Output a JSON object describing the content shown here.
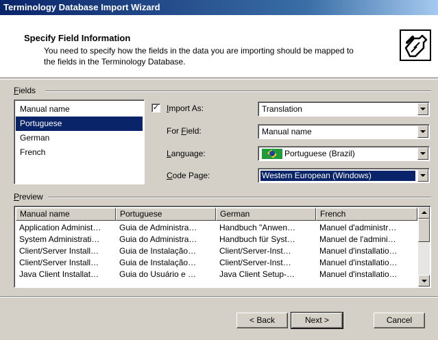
{
  "window": {
    "title": "Terminology Database Import Wizard"
  },
  "header": {
    "title": "Specify Field Information",
    "description": "You need to specify how the fields in the data you are importing should be mapped to the fields in the Terminology Database.",
    "logo_icon": "wizard-tools-icon"
  },
  "fields": {
    "group_label": "Fields",
    "items": [
      "Manual name",
      "Portuguese",
      "German",
      "French"
    ],
    "selected_index": 1
  },
  "import_as": {
    "checked": true,
    "check_glyph": "✓",
    "label": "Import As:",
    "value": "Translation"
  },
  "for_field": {
    "label": "For Field:",
    "value": "Manual name"
  },
  "language": {
    "label": "Language:",
    "value": "Portuguese (Brazil)",
    "flag_icon": "brazil-flag-icon"
  },
  "code_page": {
    "label": "Code Page:",
    "value": "Western European (Windows)"
  },
  "preview": {
    "group_label": "Preview",
    "columns": [
      "Manual name",
      "Portuguese",
      "German",
      "French"
    ],
    "rows": [
      [
        "Application Administ…",
        "Guia de Administra…",
        "Handbuch \"Anwen…",
        "Manuel d'administr…"
      ],
      [
        "System Administrati…",
        "Guia do Administra…",
        "Handbuch für Syst…",
        "Manuel de l'admini…"
      ],
      [
        "Client/Server Install…",
        "Guia de Instalação…",
        "Client/Server-Inst…",
        "Manuel d'installatio…"
      ],
      [
        "Client/Server Install…",
        "Guia de Instalação…",
        "Client/Server-Inst…",
        "Manuel d'installatio…"
      ],
      [
        "Java Client Installat…",
        "Guia do Usuário e …",
        "Java Client Setup-…",
        "Manuel d'installatio…"
      ]
    ]
  },
  "buttons": {
    "back": "< Back",
    "next": "Next >",
    "cancel": "Cancel"
  },
  "colors": {
    "title_bar": "#0a246a",
    "selection": "#0a246a",
    "face": "#d4d0c8"
  }
}
